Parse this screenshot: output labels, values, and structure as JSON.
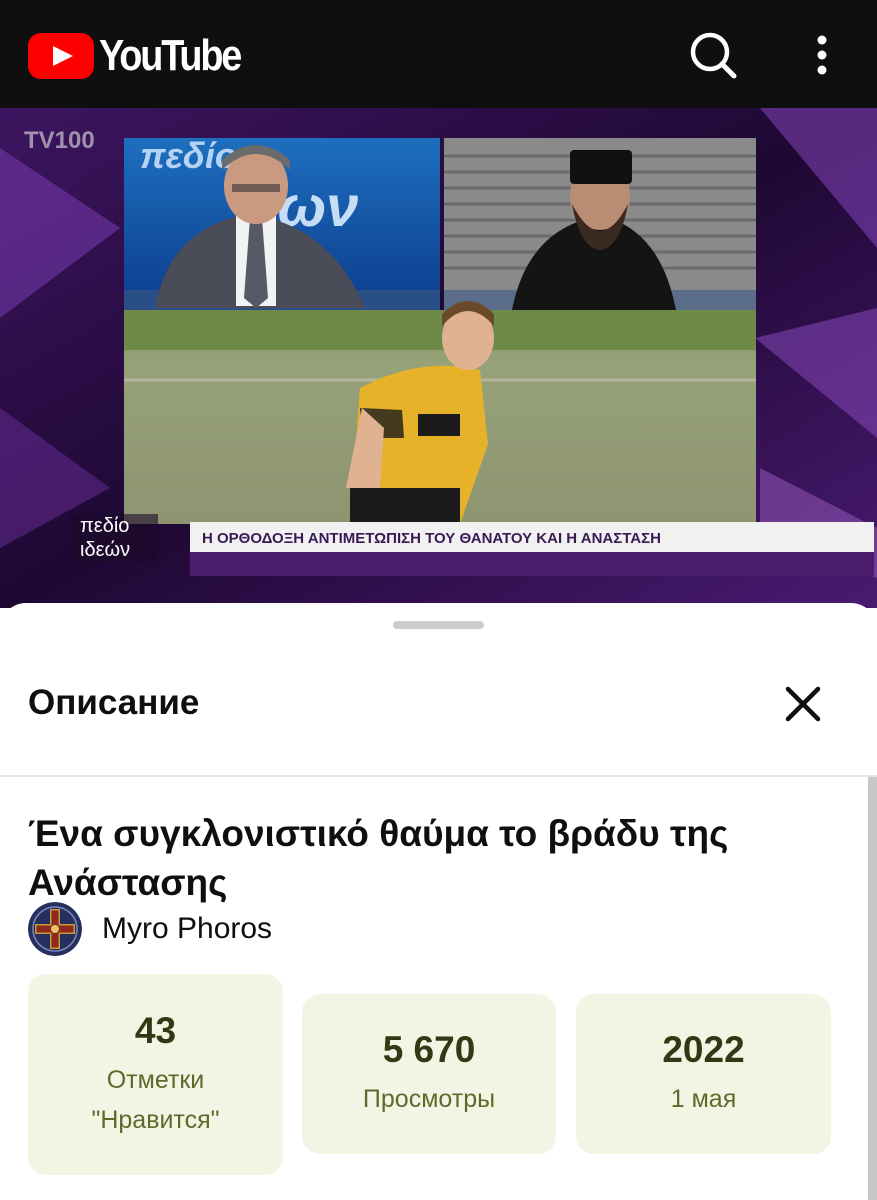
{
  "app": {
    "logo_text": "YouTube",
    "brand_color": "#ff0000"
  },
  "header": {
    "icons": [
      "search-icon",
      "more-vert-icon"
    ]
  },
  "video": {
    "channel_bug": "TV100",
    "show_logo_line1": "πεδίο",
    "show_logo_line2": "ιδεών",
    "lower_third": "Η ΟΡΘΟΔΟΞΗ ΑΝΤΙΜΕΤΩΠΙΣΗ ΤΟΥ ΘΑΝΑΤΟΥ ΚΑΙ Η ΑΝΑΣΤΑΣΗ"
  },
  "description_panel": {
    "title": "Описание",
    "close_icon": "close-icon"
  },
  "details": {
    "video_title": "Ένα συγκλονιστικό θαύμα το βράδυ της Ανάστασης",
    "channel_name": "Myro Phoros",
    "stats": {
      "likes_value": "43",
      "likes_label": "Отметки \"Нравится\"",
      "views_value": "5 670",
      "views_label": "Просмотры",
      "year": "2022",
      "date": "1 мая"
    }
  }
}
